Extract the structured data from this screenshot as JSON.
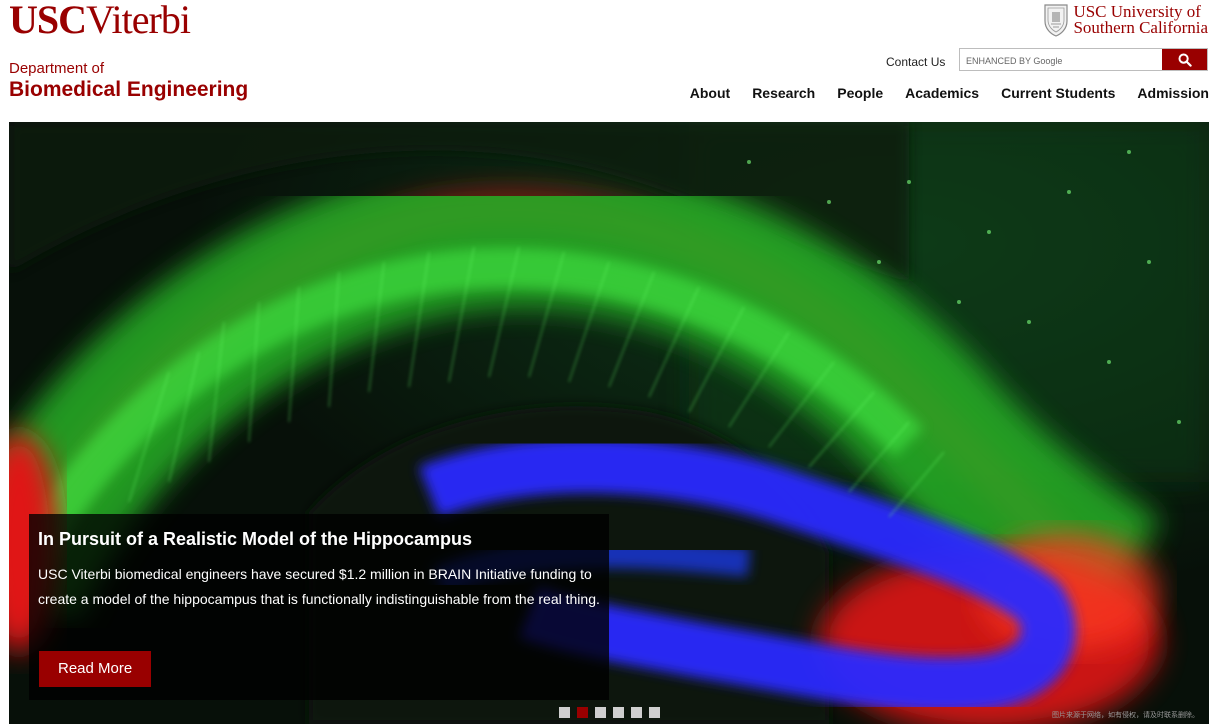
{
  "header": {
    "logo_usc": "USC",
    "logo_viterbi": "Viterbi",
    "university_line1": "USC University of",
    "university_line2": "Southern California",
    "department_sub": "Department of",
    "department_main": "Biomedical Engineering",
    "contact_label": "Contact Us",
    "search_placeholder": "ENHANCED BY Google"
  },
  "nav": {
    "items": [
      "About",
      "Research",
      "People",
      "Academics",
      "Current Students",
      "Admission"
    ]
  },
  "hero": {
    "title": "In Pursuit of a Realistic Model of the Hippocampus",
    "body": "USC Viterbi biomedical engineers have secured $1.2 million in BRAIN Initiative funding to create a model of the hippocampus that is functionally indistinguishable from the real thing.",
    "cta_label": "Read More",
    "slide_count": 6,
    "active_slide": 2,
    "credit": "图片来源于网络，如有侵权，请及时联系删除。"
  },
  "colors": {
    "brand": "#990000",
    "neuron_green": "#3ce03c",
    "stain_red": "#e01818",
    "stain_blue": "#2020ff"
  },
  "icons": {
    "search": "search-icon",
    "seal": "university-seal-icon"
  }
}
